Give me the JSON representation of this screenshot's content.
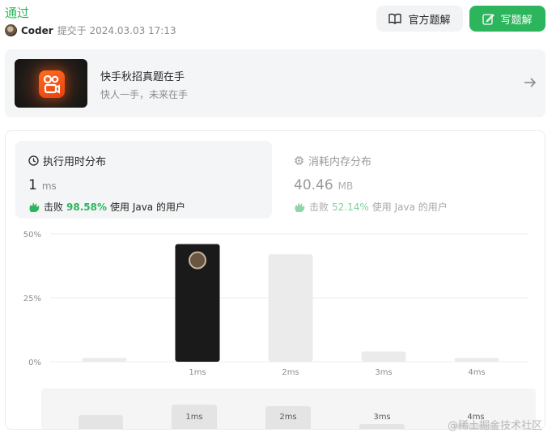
{
  "header": {
    "status": "通过",
    "username": "Coder",
    "submitted_label": "提交于 2024.03.03 17:13",
    "official_solution_label": "官方题解",
    "write_solution_label": "写题解"
  },
  "banner": {
    "title": "快手秋招真题在手",
    "subtitle": "快人一手，未来在手"
  },
  "runtime": {
    "title": "执行用时分布",
    "value": "1",
    "unit": "ms",
    "beats_label": "击败",
    "beats_pct": "98.58%",
    "users_label": "使用 Java 的用户"
  },
  "memory": {
    "title": "消耗内存分布",
    "value": "40.46",
    "unit": "MB",
    "beats_label": "击败",
    "beats_pct": "52.14%",
    "users_label": "使用 Java 的用户"
  },
  "chart_data": {
    "type": "bar",
    "yticks": [
      "50%",
      "25%",
      "0%"
    ],
    "ylim": [
      0,
      50
    ],
    "categories": [
      "",
      "1ms",
      "2ms",
      "3ms",
      "4ms"
    ],
    "values": [
      1.5,
      46,
      42,
      4,
      1.5
    ],
    "highlight_index": 1,
    "grid": true,
    "colors": {
      "bar": "#ebebeb",
      "highlight": "#1a1a1a",
      "grid": "#ececec"
    }
  },
  "overview": {
    "labels": [
      "1ms",
      "2ms",
      "3ms",
      "4ms"
    ],
    "values": [
      30,
      28,
      6,
      6
    ]
  },
  "watermark": "@稀土掘金技术社区",
  "colors": {
    "accent": "#2db55d"
  }
}
